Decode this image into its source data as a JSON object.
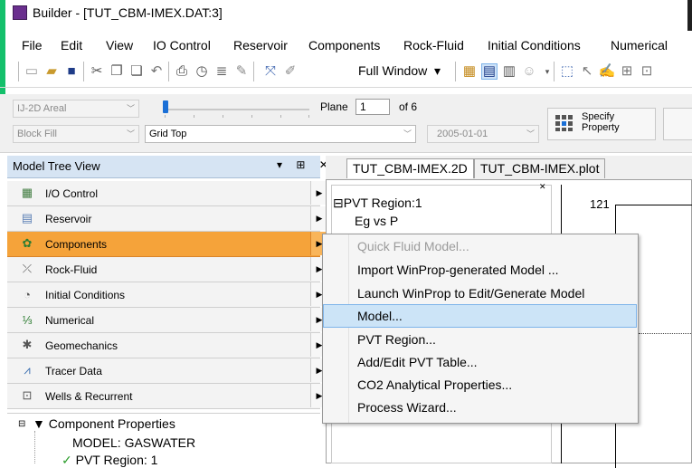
{
  "window": {
    "title": "Builder - [TUT_CBM-IMEX.DAT:3]"
  },
  "menu": [
    "File",
    "Edit",
    "View",
    "IO Control",
    "Reservoir",
    "Components",
    "Rock-Fluid",
    "Initial Conditions",
    "Numerical"
  ],
  "toolbar": {
    "view_mode": "Full Window",
    "view_mode_arrow": "▾"
  },
  "property_bar": {
    "view_combo": "IJ-2D Areal",
    "fill_combo": "Block Fill",
    "layer_combo": "Grid Top",
    "date_combo": "2005-01-01",
    "plane_label": "Plane",
    "plane_value": "1",
    "plane_of": "of 6",
    "specify_line1": "Specify",
    "specify_line2": "Property"
  },
  "model_tree": {
    "title": "Model Tree View",
    "controls": "▾ ⊞ ✕",
    "nav_items": [
      {
        "label": "I/O Control",
        "icon": "io-control-icon",
        "active": false
      },
      {
        "label": "Reservoir",
        "icon": "reservoir-icon",
        "active": false
      },
      {
        "label": "Components",
        "icon": "components-icon",
        "active": true
      },
      {
        "label": "Rock-Fluid",
        "icon": "rock-fluid-icon",
        "active": false
      },
      {
        "label": "Initial Conditions",
        "icon": "initial-conditions-icon",
        "active": false
      },
      {
        "label": "Numerical",
        "icon": "numerical-icon",
        "active": false
      },
      {
        "label": "Geomechanics",
        "icon": "geomechanics-icon",
        "active": false
      },
      {
        "label": "Tracer Data",
        "icon": "tracer-data-icon",
        "active": false
      },
      {
        "label": "Wells & Recurrent",
        "icon": "wells-recurrent-icon",
        "active": false
      }
    ],
    "tree": {
      "component_properties": "Component Properties",
      "model": "MODEL: GASWATER",
      "pvt_region": "PVT Region: 1"
    }
  },
  "documents": {
    "tabs": [
      "TUT_CBM-IMEX.2D",
      "TUT_CBM-IMEX.plot"
    ],
    "pvt_tree": {
      "region": "PVT Region:1",
      "child": "Eg vs P"
    },
    "plot": {
      "y_top_label": "121"
    }
  },
  "context_menu": {
    "items": [
      {
        "label": "Quick Fluid Model...",
        "enabled": false,
        "highlighted": false
      },
      {
        "label": "Import WinProp-generated Model ...",
        "enabled": true,
        "highlighted": false
      },
      {
        "label": "Launch WinProp to Edit/Generate Model",
        "enabled": true,
        "highlighted": false
      },
      {
        "label": "Model...",
        "enabled": true,
        "highlighted": true
      },
      {
        "label": "PVT Region...",
        "enabled": true,
        "highlighted": false
      },
      {
        "label": "Add/Edit PVT Table...",
        "enabled": true,
        "highlighted": false
      },
      {
        "label": "CO2 Analytical Properties...",
        "enabled": true,
        "highlighted": false
      },
      {
        "label": "Process Wizard...",
        "enabled": true,
        "highlighted": false
      }
    ]
  },
  "colors": {
    "accent_green": "#14c06b",
    "active_nav": "#f5a33a",
    "menu_highlight": "#cce4f7",
    "tree_header": "#d6e4f3"
  }
}
